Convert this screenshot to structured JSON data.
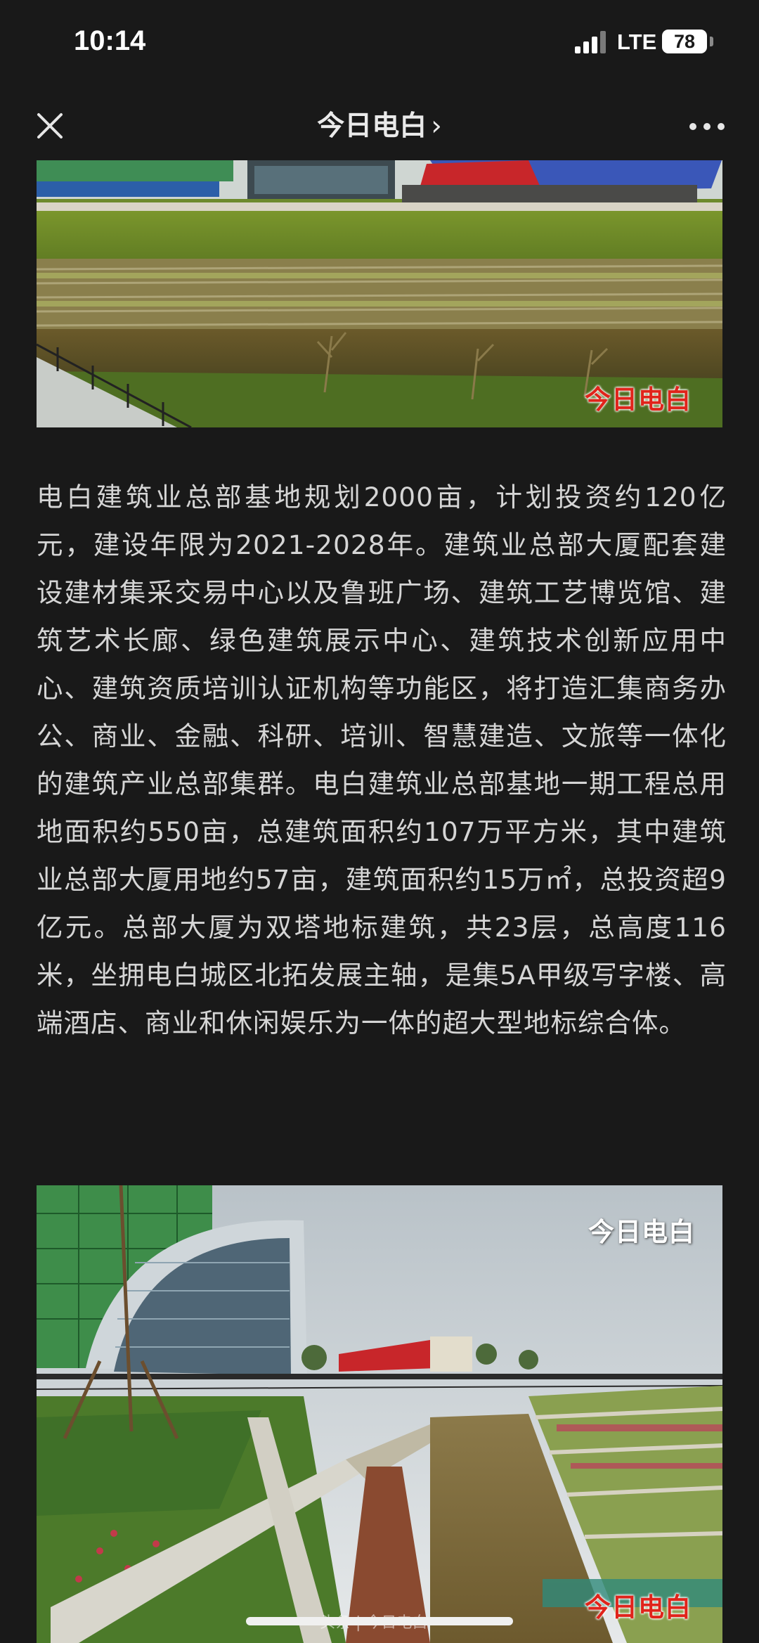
{
  "status_bar": {
    "time": "10:14",
    "network": "LTE",
    "battery": "78"
  },
  "nav": {
    "title": "今日电白",
    "chevron": "›"
  },
  "images": {
    "top_watermark": "今日电白",
    "bottom_watermark_top": "今日电白",
    "bottom_watermark_bottom": "今日电白"
  },
  "article": {
    "paragraph": "电白建筑业总部基地规划2000亩，计划投资约120亿元，建设年限为2021-2028年。建筑业总部大厦配套建设建材集采交易中心以及鲁班广场、建筑工艺博览馆、建筑艺术长廊、绿色建筑展示中心、建筑技术创新应用中心、建筑资质培训认证机构等功能区，将打造汇集商务办公、商业、金融、科研、培训、智慧建造、文旅等一体化的建筑产业总部集群。电白建筑业总部基地一期工程总用地面积约550亩，总建筑面积约107万平方米，其中建筑业总部大厦用地约57亩，建筑面积约15万㎡，总投资超9亿元。总部大厦为双塔地标建筑，共23层，总高度116米，坐拥电白城区北拓发展主轴，是集5A甲级写字楼、高端酒店、商业和休闲娱乐为一体的超大型地标综合体。"
  },
  "footer": {
    "source_mark": "头条 | 今日电白"
  },
  "colors": {
    "background": "#191919",
    "text": "#d5d5d5",
    "watermark_red": "#e0241b"
  },
  "icons": {
    "close": "close-icon",
    "more": "more-icon",
    "signal": "signal-icon",
    "battery": "battery-icon"
  }
}
